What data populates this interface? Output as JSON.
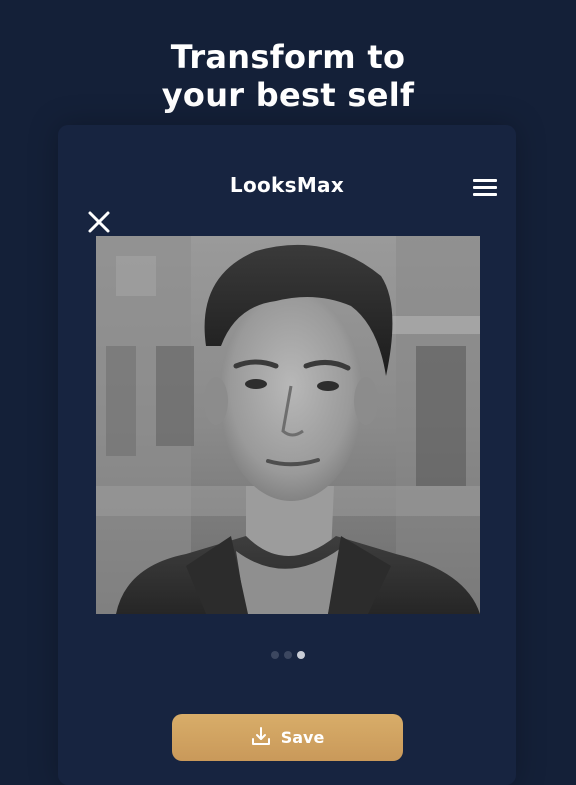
{
  "headline": {
    "line1": "Transform to",
    "line2": "your best self"
  },
  "app": {
    "title": "LooksMax",
    "menu_icon": "hamburger-menu-icon",
    "close_icon": "close-icon"
  },
  "photo": {
    "description_icon": "portrait-photo"
  },
  "pager": {
    "total": 3,
    "active_index": 2
  },
  "save_button": {
    "label": "Save",
    "icon": "download-icon"
  },
  "colors": {
    "background": "#142038",
    "card": "#172440",
    "accent_gold": "#d4a866",
    "text": "#ffffff"
  }
}
